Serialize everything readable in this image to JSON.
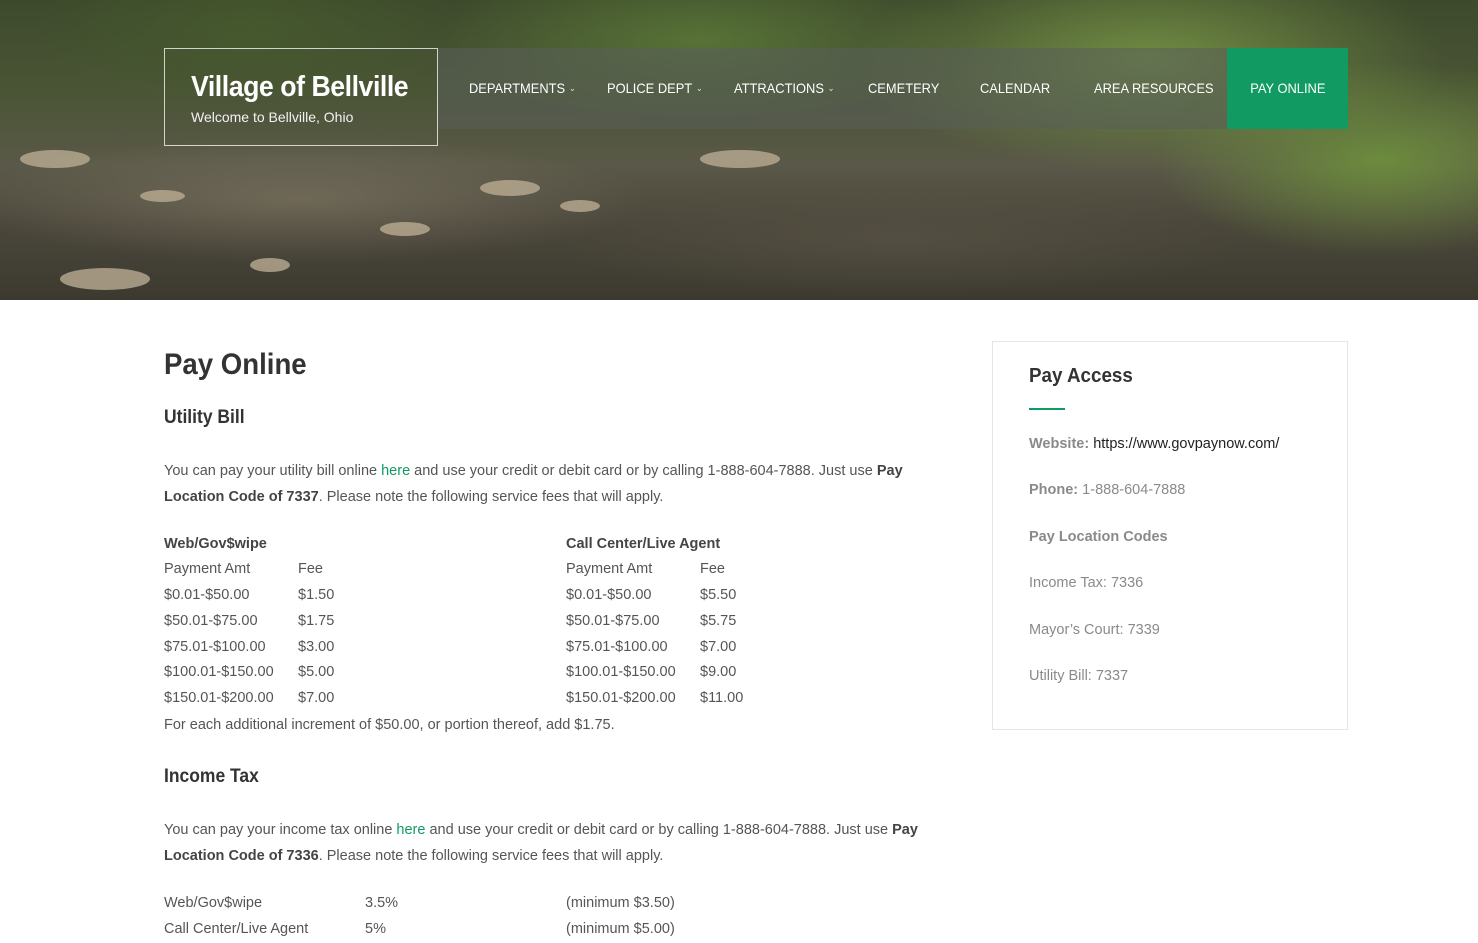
{
  "header": {
    "site_title": "Village of Bellville",
    "tagline": "Welcome to Bellville, Ohio",
    "nav": [
      {
        "label": "DEPARTMENTS",
        "has_submenu": true
      },
      {
        "label": "POLICE DEPT",
        "has_submenu": true
      },
      {
        "label": "ATTRACTIONS",
        "has_submenu": true
      },
      {
        "label": "CEMETERY",
        "has_submenu": false
      },
      {
        "label": "CALENDAR",
        "has_submenu": false
      },
      {
        "label": "AREA RESOURCES",
        "has_submenu": false
      }
    ],
    "active_nav": "PAY ONLINE",
    "accent_color": "#119b63"
  },
  "main": {
    "page_title": "Pay Online",
    "utility": {
      "heading": "Utility Bill",
      "text_before_link": "You can pay your utility bill online ",
      "link_text": "here",
      "text_after_link": " and use your credit or debit card or by calling 1-888-604-7888. Just use ",
      "bold_code": "Pay Location Code of 7337",
      "text_end": ". Please note the following service fees that will apply.",
      "web_heading": "Web/Gov$wipe",
      "call_heading": "Call Center/Live Agent",
      "col_amt": "Payment Amt",
      "col_fee": "Fee",
      "web_rows": [
        {
          "amt": "$0.01-$50.00",
          "fee": "$1.50"
        },
        {
          "amt": "$50.01-$75.00",
          "fee": "$1.75"
        },
        {
          "amt": "$75.01-$100.00",
          "fee": "$3.00"
        },
        {
          "amt": "$100.01-$150.00",
          "fee": "$5.00"
        },
        {
          "amt": "$150.01-$200.00",
          "fee": "$7.00"
        }
      ],
      "call_rows": [
        {
          "amt": "$0.01-$50.00",
          "fee": "$5.50"
        },
        {
          "amt": "$50.01-$75.00",
          "fee": "$5.75"
        },
        {
          "amt": "$75.01-$100.00",
          "fee": "$7.00"
        },
        {
          "amt": "$100.01-$150.00",
          "fee": "$9.00"
        },
        {
          "amt": "$150.01-$200.00",
          "fee": "$11.00"
        }
      ],
      "footnote": "For each additional increment of $50.00, or portion thereof, add $1.75."
    },
    "income": {
      "heading": "Income Tax",
      "text_before_link": "You can pay your income tax online ",
      "link_text": "here",
      "text_after_link": " and use your credit or debit card or by calling 1-888-604-7888. Just use ",
      "bold_code": "Pay Location Code of 7336",
      "text_end": ". Please note the following service fees that will apply.",
      "rows": [
        {
          "method": "Web/Gov$wipe",
          "rate": "3.5%",
          "minimum": "(minimum $3.50)"
        },
        {
          "method": "Call Center/Live Agent",
          "rate": "5%",
          "minimum": "(minimum $5.00)"
        }
      ]
    }
  },
  "sidebar": {
    "title": "Pay Access",
    "website_label": "Website:",
    "website_value": "https://www.govpaynow.com/",
    "phone_label": "Phone:",
    "phone_value": "1-888-604-7888",
    "codes_heading": "Pay Location Codes",
    "codes": [
      "Income Tax: 7336",
      "Mayor’s Court: 7339",
      "Utility Bill: 7337"
    ]
  }
}
